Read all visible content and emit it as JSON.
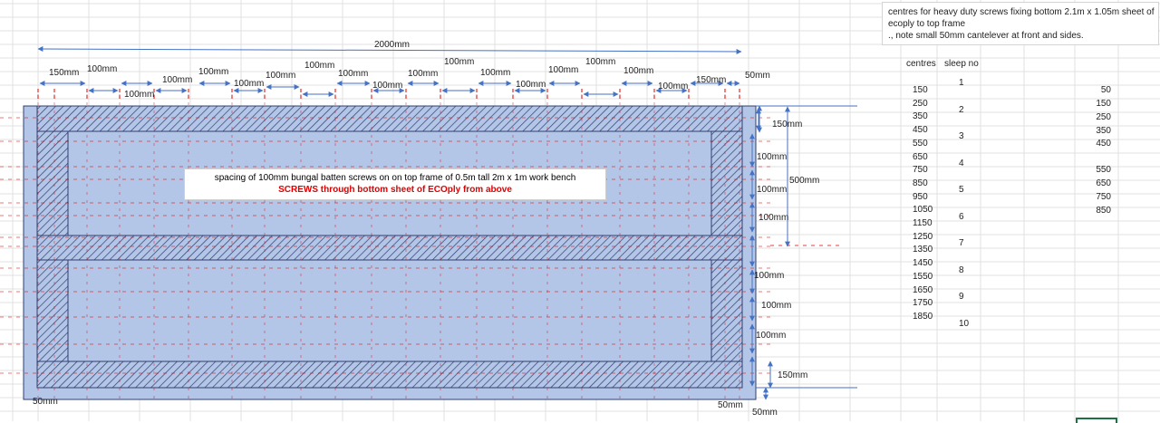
{
  "note": {
    "line1": "centres for heavy duty screws fixing bottom 2.1m x 1.05m sheet of",
    "line2": "ecoply to top frame",
    "line3": "., note small 50mm cantelever at front and sides."
  },
  "center_note": {
    "line1": "spacing of 100mm bungal batten screws  on  on top frame of  0.5m tall 2m x 1m work bench",
    "line2": "SCREWS through bottom sheet of ECOply from above"
  },
  "top_dims": {
    "total": "2000mm",
    "first": "150mm",
    "last": "150mm",
    "overhang": "50mm",
    "spacing": "100mm"
  },
  "right_dims": {
    "first": "150mm",
    "half": "500mm",
    "last": "150mm",
    "overhang": "50mm",
    "spacing": "100mm"
  },
  "bottom_dims": {
    "left": "50mm",
    "right": "50mm"
  },
  "table": {
    "col_centres": "centres",
    "col_sleep": "sleep no",
    "centres": [
      "150",
      "250",
      "350",
      "450",
      "550",
      "650",
      "750",
      "850",
      "950",
      "1050",
      "1150",
      "1250",
      "1350",
      "1450",
      "1550",
      "1650",
      "1750",
      "1850"
    ],
    "sleep_nos": [
      "1",
      "2",
      "3",
      "4",
      "5",
      "6",
      "7",
      "8",
      "9",
      "10"
    ],
    "right_col": [
      "50",
      "150",
      "250",
      "350",
      "450",
      "550",
      "650",
      "750",
      "850"
    ]
  },
  "colors": {
    "sheet_fill": "#b4c6e7",
    "frame_stroke": "#2f3f6f",
    "dim_arrow": "#4472c4",
    "screw_line": "#e00000"
  }
}
